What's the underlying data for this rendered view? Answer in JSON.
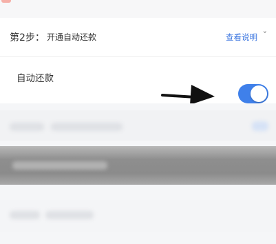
{
  "step": {
    "title": "第2步：",
    "subtitle": "开通自动还款",
    "view_label": "查看说明"
  },
  "auto_repay": {
    "label": "自动还款",
    "enabled": true
  },
  "colors": {
    "accent": "#3f80ea",
    "link": "#3f78e0"
  },
  "icons": {
    "view_chevron": "chevron-down-icon",
    "pointer": "arrow-right-icon"
  }
}
